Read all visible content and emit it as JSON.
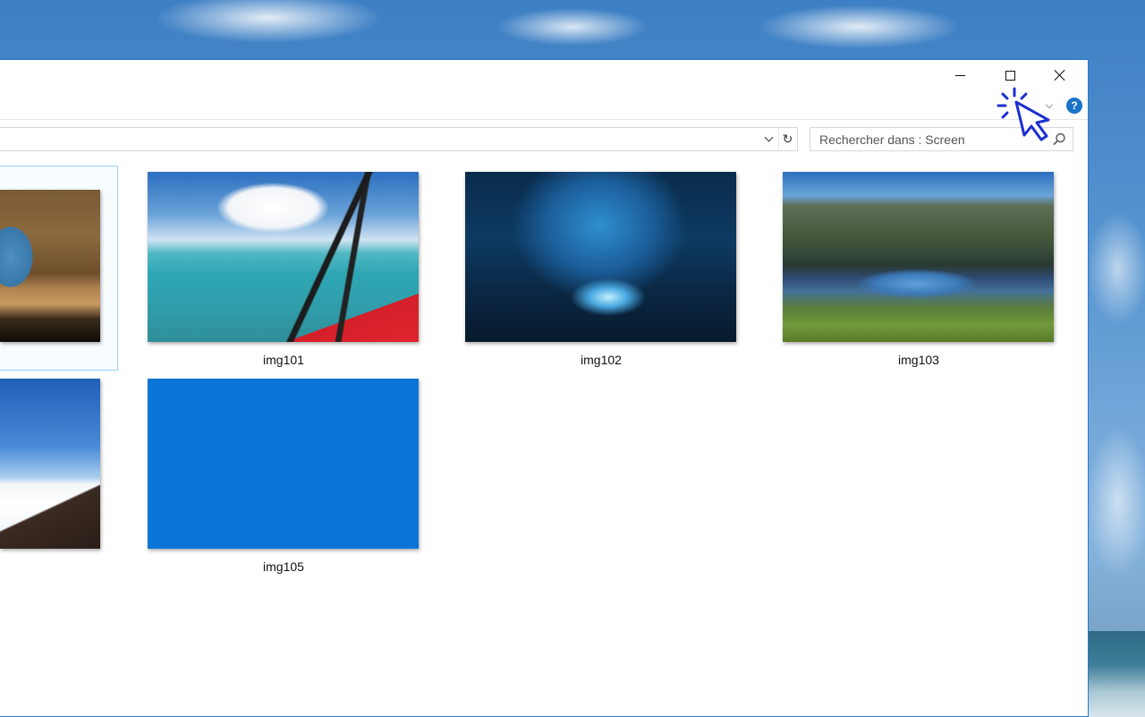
{
  "window": {
    "controls": {
      "minimize_icon": "minimize-icon",
      "maximize_icon": "maximize-icon",
      "close_icon": "close-icon"
    },
    "help_label": "?"
  },
  "address_bar": {
    "refresh_glyph": "↻"
  },
  "search": {
    "placeholder": "Rechercher dans : Screen"
  },
  "files": [
    {
      "name": "",
      "thumb": "cave",
      "selected": true
    },
    {
      "name": "img101",
      "thumb": "plane-wing-over-sea"
    },
    {
      "name": "img102",
      "thumb": "ice-cave"
    },
    {
      "name": "img103",
      "thumb": "mountain-lake"
    },
    {
      "name": "",
      "thumb": "sky-above-clouds"
    },
    {
      "name": "img105",
      "thumb": "solid-blue"
    }
  ],
  "colors": {
    "accent": "#2b79d0",
    "selection_border": "#99d1f3",
    "help_blue": "#1a73c7",
    "solid_blue_thumb": "#0a75d6",
    "cursor_blue": "#1a2fd0"
  }
}
